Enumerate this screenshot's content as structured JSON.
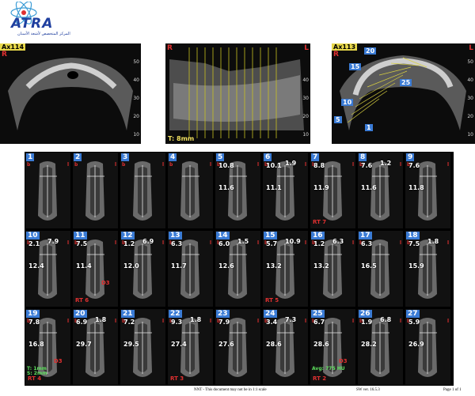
{
  "logo": {
    "brand": "ATRA",
    "subtitle": "المركز المتخصص لأشعة الأسنان"
  },
  "views": [
    {
      "axial_label": "Ax114",
      "side_r": "R",
      "side_l": "L",
      "ticks": [
        "10",
        "20",
        "30",
        "40",
        "50"
      ]
    },
    {
      "side_r": "R",
      "side_l": "L",
      "thickness": "T: 8mm",
      "ticks": [
        "10",
        "20",
        "30",
        "40"
      ]
    },
    {
      "axial_label": "Ax113",
      "side_r": "R",
      "side_l": "L",
      "ticks": [
        "10",
        "20",
        "30",
        "40",
        "50"
      ],
      "markers": [
        "20",
        "15",
        "10",
        "5",
        "25",
        "1"
      ]
    }
  ],
  "cells": [
    {
      "n": "1"
    },
    {
      "n": "2"
    },
    {
      "n": "3"
    },
    {
      "n": "4"
    },
    {
      "n": "5",
      "m": [
        "10.8",
        "11.6"
      ]
    },
    {
      "n": "6",
      "m": [
        "10.1",
        "1.9",
        "11.1"
      ]
    },
    {
      "n": "7",
      "m": [
        "8.8",
        "11.9"
      ],
      "rt": "RT 7"
    },
    {
      "n": "8",
      "m": [
        "7.6",
        "1.2",
        "11.6"
      ]
    },
    {
      "n": "9",
      "m": [
        "7.6",
        "11.8"
      ]
    },
    {
      "n": "10",
      "m": [
        "2.1",
        "7.9",
        "12.4"
      ]
    },
    {
      "n": "11",
      "m": [
        "7.5",
        "11.4"
      ],
      "rt": "RT 6",
      "d3": "D3"
    },
    {
      "n": "12",
      "m": [
        "1.2",
        "6.9",
        "12.0"
      ]
    },
    {
      "n": "13",
      "m": [
        "6.3",
        "11.7"
      ]
    },
    {
      "n": "14",
      "m": [
        "6.0",
        "1.5",
        "12.6"
      ]
    },
    {
      "n": "15",
      "m": [
        "5.7",
        "10.9",
        "13.2"
      ],
      "rt": "RT 5"
    },
    {
      "n": "16",
      "m": [
        "1.2",
        "6.3",
        "13.2"
      ]
    },
    {
      "n": "17",
      "m": [
        "6.3",
        "16.5"
      ]
    },
    {
      "n": "18",
      "m": [
        "7.5",
        "1.8",
        "15.9"
      ]
    },
    {
      "n": "19",
      "m": [
        "7.8",
        "16.8"
      ],
      "rt": "RT 4",
      "d3": "D3",
      "g1": "T: 1mm",
      "g2": "S: 2mm"
    },
    {
      "n": "20",
      "m": [
        "6.9",
        "1.8",
        "29.7"
      ]
    },
    {
      "n": "21",
      "m": [
        "7.2",
        "29.5"
      ]
    },
    {
      "n": "22",
      "m": [
        "9.3",
        "1.8",
        "27.4"
      ],
      "rt": "RT 3"
    },
    {
      "n": "23",
      "m": [
        "7.9",
        "27.6"
      ]
    },
    {
      "n": "24",
      "m": [
        "3.4",
        "7.3",
        "28.6"
      ]
    },
    {
      "n": "25",
      "m": [
        "6.7",
        "28.6"
      ],
      "rt": "RT 2",
      "d3": "D3",
      "g1": "Avg: 775 HU"
    },
    {
      "n": "26",
      "m": [
        "1.9",
        "6.8",
        "28.2"
      ]
    },
    {
      "n": "27",
      "m": [
        "5.9",
        "26.9"
      ]
    }
  ],
  "footer": {
    "center": "NNT - This document may not be in 1:1 scale",
    "sw": "SW ver. 16.5.3",
    "page": "Page 1 of 1"
  }
}
